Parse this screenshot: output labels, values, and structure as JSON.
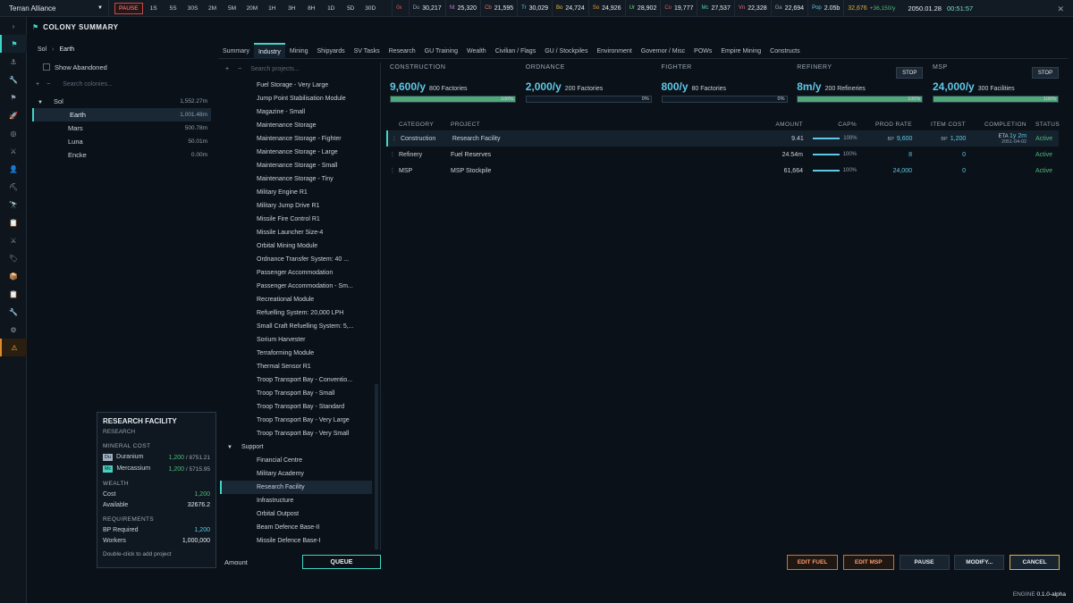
{
  "topbar": {
    "empire": "Terran Alliance",
    "speed_buttons": [
      "PAUSE",
      "1S",
      "5S",
      "30S",
      "2M",
      "5M",
      "20M",
      "1H",
      "3H",
      "8H",
      "1D",
      "5D",
      "30D"
    ],
    "resources": [
      {
        "abbr": "0x",
        "value": "",
        "color": "#e05a5a"
      },
      {
        "abbr": "Du",
        "value": "30,217",
        "color": "#8fa0b0"
      },
      {
        "abbr": "Nt",
        "value": "25,320",
        "color": "#c07ad8"
      },
      {
        "abbr": "Cb",
        "value": "21,595",
        "color": "#e07a6a"
      },
      {
        "abbr": "Tr",
        "value": "30,029",
        "color": "#5fc8e6"
      },
      {
        "abbr": "Bo",
        "value": "24,724",
        "color": "#e0c04a"
      },
      {
        "abbr": "So",
        "value": "24,926",
        "color": "#e0a040"
      },
      {
        "abbr": "Ur",
        "value": "28,902",
        "color": "#7ad86a"
      },
      {
        "abbr": "Co",
        "value": "19,777",
        "color": "#e05a5a"
      },
      {
        "abbr": "Mc",
        "value": "27,537",
        "color": "#4ad0c0"
      },
      {
        "abbr": "Vn",
        "value": "22,328",
        "color": "#e06a8a"
      },
      {
        "abbr": "Ga",
        "value": "22,694",
        "color": "#8fa0b0"
      },
      {
        "abbr": "Pop",
        "value": "2.05b",
        "color": "#5fc8e6"
      }
    ],
    "wealth": "32,676",
    "wealth_delta": "+36,150/y",
    "date": "2050.01.28",
    "time": "00:51:57"
  },
  "window": {
    "title": "COLONY SUMMARY"
  },
  "colonies": {
    "breadcrumb": [
      "Sol",
      "Earth"
    ],
    "show_abandoned": "Show Abandoned",
    "search_placeholder": "Search colonies...",
    "system": {
      "name": "Sol",
      "pop": "1,552.27m"
    },
    "planets": [
      {
        "name": "Earth",
        "pop": "1,001.48m"
      },
      {
        "name": "Mars",
        "pop": "500.78m"
      },
      {
        "name": "Luna",
        "pop": "50.01m"
      },
      {
        "name": "Encke",
        "pop": "0.00m"
      }
    ]
  },
  "tabs": [
    "Summary",
    "Industry",
    "Mining",
    "Shipyards",
    "SV Tasks",
    "Research",
    "GU Training",
    "Wealth",
    "Civilian / Flags",
    "GU / Stockpiles",
    "Environment",
    "Governor / Misc",
    "POWs",
    "Empire Mining",
    "Constructs"
  ],
  "projects": {
    "search_placeholder": "Search projects...",
    "items": [
      "Fuel Storage - Very Large",
      "Jump Point Stabilisation Module",
      "Magazine - Small",
      "Maintenance Storage",
      "Maintenance Storage - Fighter",
      "Maintenance Storage - Large",
      "Maintenance Storage - Small",
      "Maintenance Storage - Tiny",
      "Military Engine R1",
      "Military Jump Drive R1",
      "Missile Fire Control R1",
      "Missile Launcher Size-4",
      "Orbital Mining Module",
      "Ordnance Transfer System: 40 ...",
      "Passenger Accommodation",
      "Passenger Accommodation - Sm...",
      "Recreational Module",
      "Refuelling System: 20,000 LPH",
      "Small Craft Refuelling System: 5,...",
      "Sorium Harvester",
      "Terraforming Module",
      "Thermal Sensor R1",
      "Troop Transport Bay - Conventio...",
      "Troop Transport Bay - Small",
      "Troop Transport Bay - Standard",
      "Troop Transport Bay - Very Large",
      "Troop Transport Bay - Very Small"
    ],
    "group": "Support",
    "group_items": [
      "Financial Centre",
      "Military Academy",
      "Research Facility",
      "Infrastructure",
      "Orbital Outpost",
      "Beam Defence Base-II",
      "Missile Defence Base-I"
    ],
    "amount_label": "Amount",
    "queue_label": "QUEUE"
  },
  "tooltip": {
    "title": "RESEARCH FACILITY",
    "subtitle": "RESEARCH",
    "mineral_header": "MINERAL COST",
    "minerals": [
      {
        "abbr": "Du",
        "name": "Duranium",
        "need": "1,200",
        "have": "8751.21",
        "color": "#9fb0c0"
      },
      {
        "abbr": "Mc",
        "name": "Mercassium",
        "need": "1,200",
        "have": "5715.95",
        "color": "#4ad0c0"
      }
    ],
    "wealth_header": "WEALTH",
    "cost_label": "Cost",
    "cost": "1,200",
    "available_label": "Available",
    "available": "32676.2",
    "req_header": "REQUIREMENTS",
    "bp_label": "BP Required",
    "bp": "1,200",
    "workers_label": "Workers",
    "workers": "1,000,000",
    "hint": "Double-click to add project"
  },
  "cards": [
    {
      "label": "CONSTRUCTION",
      "rate": "9,600/y",
      "desc": "800 Factories",
      "pct": "100%",
      "fill": 1.0,
      "stop": ""
    },
    {
      "label": "ORDNANCE",
      "rate": "2,000/y",
      "desc": "200 Factories",
      "pct": "0%",
      "fill": 0.0,
      "stop": ""
    },
    {
      "label": "FIGHTER",
      "rate": "800/y",
      "desc": "80 Factories",
      "pct": "0%",
      "fill": 0.0,
      "stop": ""
    },
    {
      "label": "REFINERY",
      "rate": "8m/y",
      "desc": "200 Refineries",
      "pct": "100%",
      "fill": 1.0,
      "stop": "STOP"
    },
    {
      "label": "MSP",
      "rate": "24,000/y",
      "desc": "300 Facilities",
      "pct": "100%",
      "fill": 1.0,
      "stop": "STOP"
    }
  ],
  "queue": {
    "headers": {
      "category": "CATEGORY",
      "project": "PROJECT",
      "amount": "AMOUNT",
      "cap": "CAP%",
      "prod": "PROD RATE",
      "cost": "ITEM COST",
      "completion": "COMPLETION",
      "status": "STATUS"
    },
    "rows": [
      {
        "category": "Construction",
        "project": "Research Facility",
        "amount": "9.41",
        "cap": "100%",
        "prod_bp": "BP",
        "prod": "9,600",
        "cost_bp": "BP",
        "cost": "1,200",
        "eta_label": "ETA",
        "eta": "1y 2m",
        "eta_date": "2051-04-02",
        "status": "Active"
      },
      {
        "category": "Refinery",
        "project": "Fuel Reserves",
        "amount": "24.54m",
        "cap": "100%",
        "prod_bp": "",
        "prod": "8",
        "cost_bp": "",
        "cost": "0",
        "eta_label": "",
        "eta": "",
        "eta_date": "",
        "status": "Active"
      },
      {
        "category": "MSP",
        "project": "MSP Stockpile",
        "amount": "61,664",
        "cap": "100%",
        "prod_bp": "",
        "prod": "24,000",
        "cost_bp": "",
        "cost": "0",
        "eta_label": "",
        "eta": "",
        "eta_date": "",
        "status": "Active"
      }
    ]
  },
  "buttons": {
    "edit_fuel": "EDIT FUEL",
    "edit_msp": "EDIT MSP",
    "pause": "PAUSE",
    "modify": "MODIFY...",
    "cancel": "CANCEL"
  },
  "engine": {
    "label": "ENGINE",
    "version": "0.1.0-alpha"
  }
}
